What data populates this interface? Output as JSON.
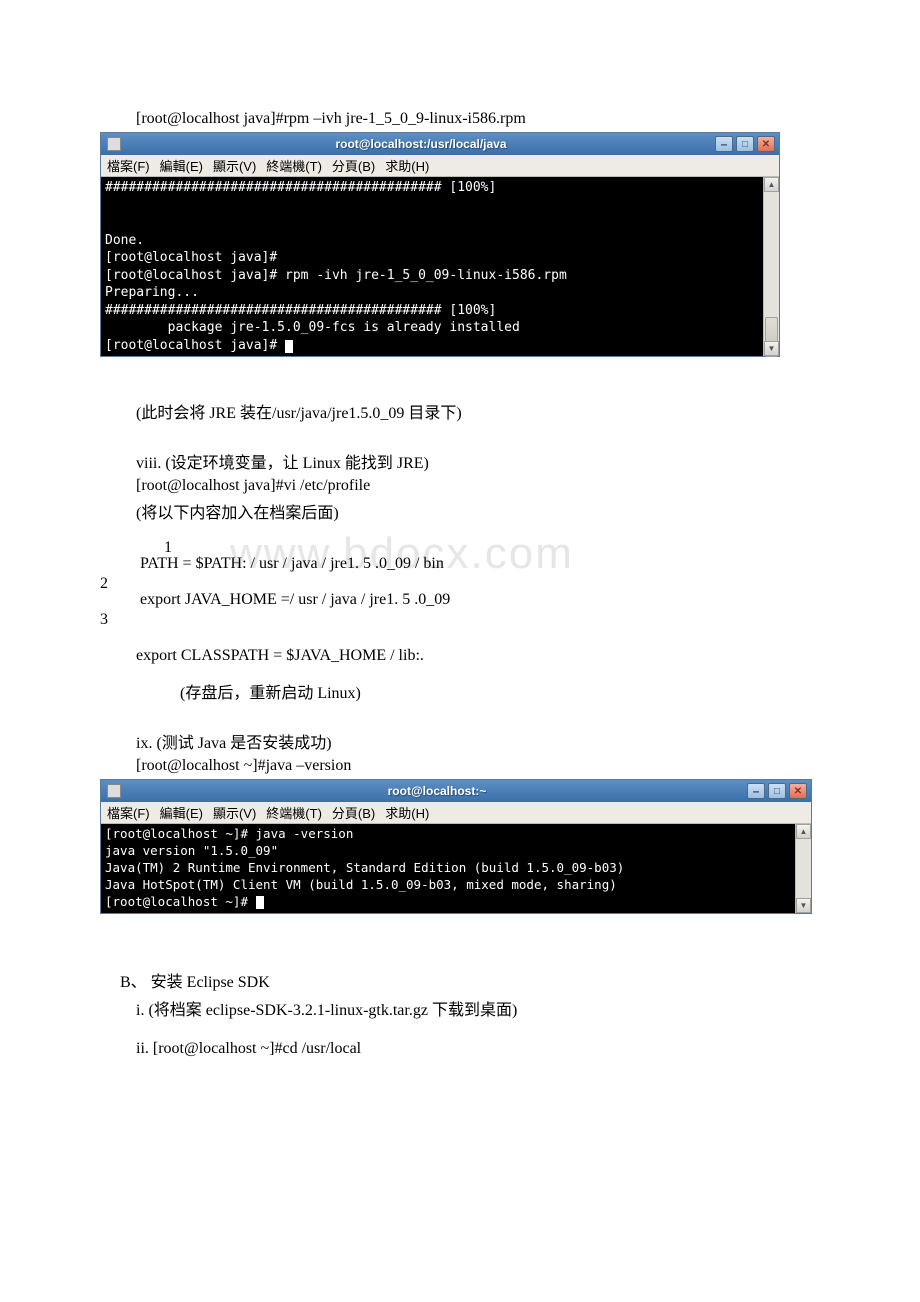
{
  "intro_cmd": "[root@localhost java]#rpm –ivh jre-1_5_0_9-linux-i586.rpm",
  "term1": {
    "title": "root@localhost:/usr/local/java",
    "menu": [
      "檔案(F)",
      "編輯(E)",
      "顯示(V)",
      "終端機(T)",
      "分頁(B)",
      "求助(H)"
    ],
    "lines": [
      "########################################### [100%]",
      "",
      "",
      "Done.",
      "[root@localhost java]#",
      "[root@localhost java]# rpm -ivh jre-1_5_0_09-linux-i586.rpm",
      "Preparing...",
      "########################################### [100%]",
      "        package jre-1.5.0_09-fcs is already installed",
      "[root@localhost java]# "
    ]
  },
  "after_term1": "(此时会将 JRE 装在/usr/java/jre1.5.0_09 目录下)",
  "step8_title": "viii. (设定环境变量，让 Linux 能找到 JRE)",
  "step8_cmd": "[root@localhost java]#vi /etc/profile",
  "step8_note": "(将以下内容加入在档案后面)",
  "code_lines": {
    "n1": "1",
    "n2": "2",
    "n3": "3",
    "l1": "PATH = $PATH: / usr / java / jre1. 5 .0_09 / bin",
    "l2": "export JAVA_HOME =/ usr / java / jre1. 5 .0_09",
    "l3": "export CLASSPATH = $JAVA_HOME / lib:."
  },
  "save_note": "(存盘后，重新启动 Linux)",
  "step9_title": "ix. (测试 Java 是否安装成功)",
  "step9_cmd": "[root@localhost ~]#java –version",
  "term2": {
    "title": "root@localhost:~",
    "menu": [
      "檔案(F)",
      "編輯(E)",
      "顯示(V)",
      "終端機(T)",
      "分頁(B)",
      "求助(H)"
    ],
    "lines": [
      "[root@localhost ~]# java -version",
      "java version \"1.5.0_09\"",
      "Java(TM) 2 Runtime Environment, Standard Edition (build 1.5.0_09-b03)",
      "Java HotSpot(TM) Client VM (build 1.5.0_09-b03, mixed mode, sharing)",
      "[root@localhost ~]# ",
      ""
    ]
  },
  "sectionB": "B、 安装 Eclipse SDK",
  "b_i": "i. (将档案 eclipse-SDK-3.2.1-linux-gtk.tar.gz 下载到桌面)",
  "b_ii": "ii. [root@localhost ~]#cd /usr/local",
  "watermark": "www.bdocx.com"
}
